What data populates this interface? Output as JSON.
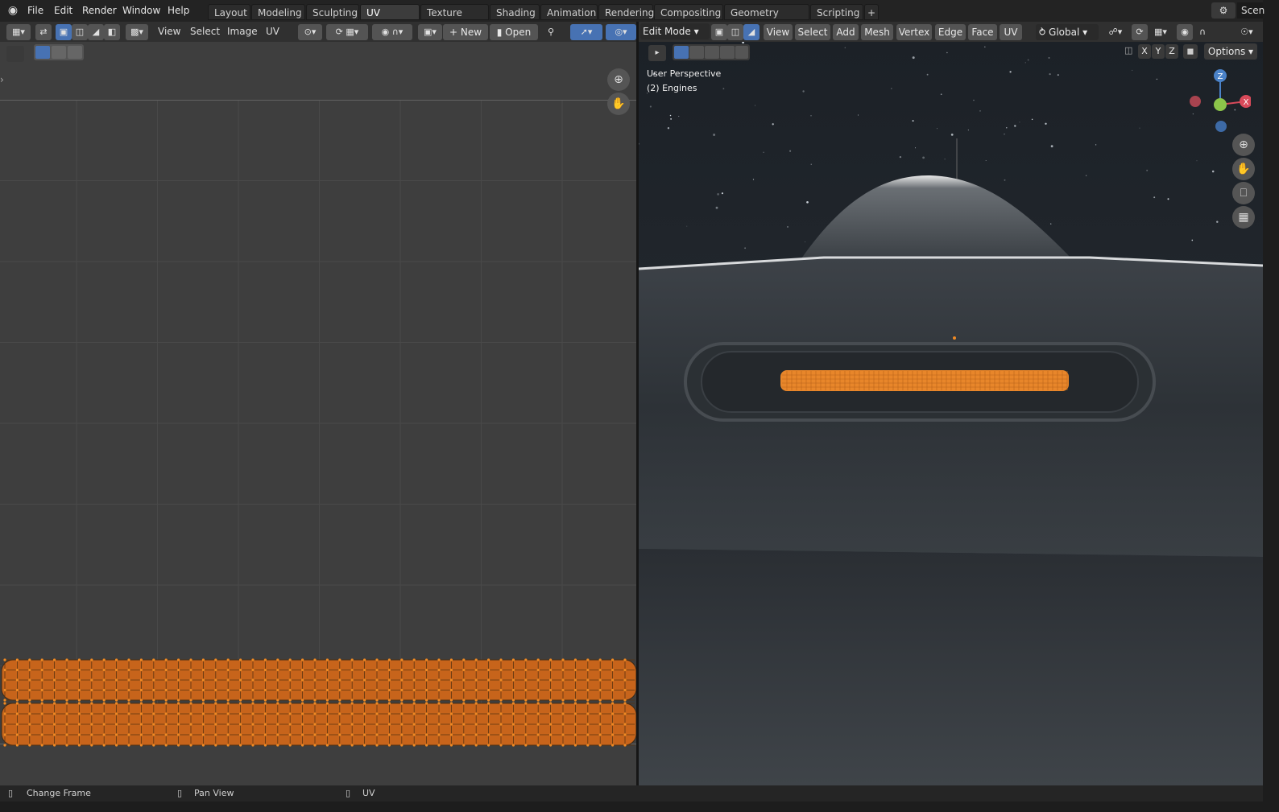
{
  "top_menu": {
    "items": [
      "File",
      "Edit",
      "Render",
      "Window",
      "Help"
    ]
  },
  "workspace_tabs": [
    "Layout",
    "Modeling",
    "Sculpting",
    "UV Editing",
    "Texture Paint",
    "Shading",
    "Animation",
    "Rendering",
    "Compositing",
    "Geometry Nodes",
    "Scripting"
  ],
  "active_tab": "UV Editing",
  "scene_label": "Scen",
  "uv_header": {
    "menus": [
      "View",
      "Select",
      "Image",
      "UV"
    ],
    "new_label": "New",
    "open_label": "Open"
  },
  "viewport_header": {
    "mode": "Edit Mode",
    "menus": [
      "View",
      "Select",
      "Add",
      "Mesh",
      "Vertex",
      "Edge",
      "Face",
      "UV"
    ],
    "orientation": "Global",
    "options_label": "Options",
    "axes": [
      "X",
      "Y",
      "Z"
    ]
  },
  "viewport_overlay": {
    "perspective": "User Perspective",
    "object": "(2) Engines"
  },
  "gizmo": {
    "z": "Z",
    "x": "X"
  },
  "status_bar": {
    "items": [
      "Change Frame",
      "Pan View",
      "UV"
    ]
  },
  "colors": {
    "selection": "#f08a24",
    "active_tab": "#3c3c3c",
    "blue_button": "#4772b3"
  }
}
